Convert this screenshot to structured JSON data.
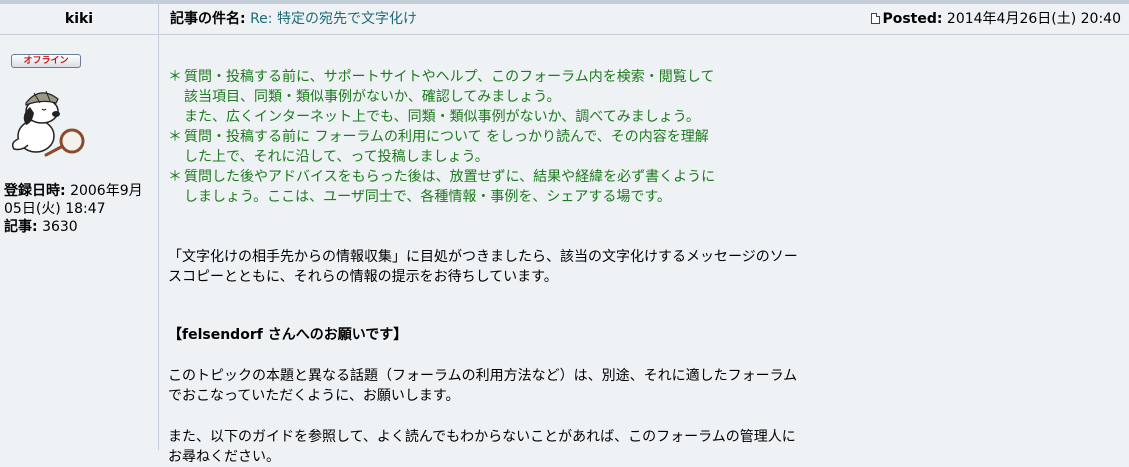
{
  "header": {
    "username": "kiki",
    "subject_label": "記事の件名:",
    "subject_value": "Re: 特定の宛先で文字化け",
    "posted_label": "Posted:",
    "posted_value": "2014年4月26日(土) 20:40"
  },
  "user": {
    "status_badge": "オフライン",
    "registered_label": "登録日時:",
    "registered_value_1": "2006年9月",
    "registered_value_2": "05日(火) 18:47",
    "posts_label": "記事:",
    "posts_value": "3630"
  },
  "message": {
    "guidelines": {
      "g1_l1": "質問・投稿する前に、サポートサイトやヘルプ、このフォーラム内を検索・閲覧して",
      "g1_l2": "該当項目、同類・類似事例がないか、確認してみましょう。",
      "g1_l3": "また、広くインターネット上でも、同類・類似事例がないか、調べてみましょう。",
      "g2_l1": "質問・投稿する前に フォーラムの利用について をしっかり読んで、その内容を理解",
      "g2_l2": "した上で、それに沿して、って投稿しましょう。",
      "g3_l1": "質問した後やアドバイスをもらった後は、放置せずに、結果や経緯を必ず書くように",
      "g3_l2": "しましょう。ここは、ユーザ同士で、各種情報・事例を、シェアする場です。",
      "bullet": "＊"
    },
    "para1_l1": "「文字化けの相手先からの情報収集」に目処がつきましたら、該当の文字化けするメッセージのソー",
    "para1_l2": "スコピーとともに、それらの情報の提示をお待ちしています。",
    "para2": "【felsendorf さんへのお願いです】",
    "para3_l1": "このトピックの本題と異なる話題（フォーラムの利用方法など）は、別途、それに適したフォーラム",
    "para3_l2": "でおこなっていただくように、お願いします。",
    "para4_l1": "また、以下のガイドを参照して、よく読んでもわからないことがあれば、このフォーラムの管理人に",
    "para4_l2": "お尋ねください。"
  },
  "colors": {
    "background": "#eef2f5",
    "guideline_text": "#1e7a1e",
    "subject_link": "#1f6a78",
    "offline_badge": "#cc1111"
  },
  "icons": {
    "avatar": "snoopy-detective-avatar",
    "post": "post-document-icon"
  }
}
